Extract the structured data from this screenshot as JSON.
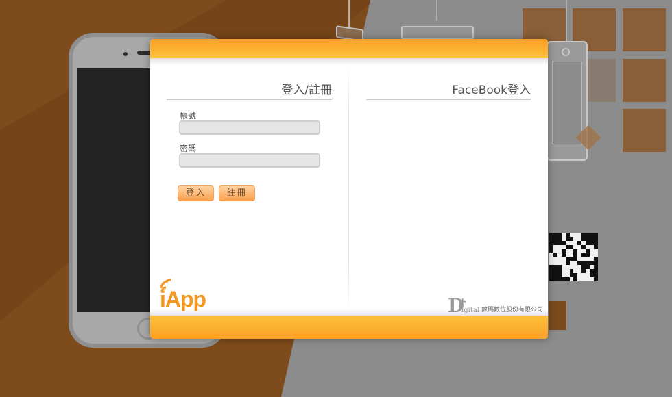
{
  "login": {
    "title": "登入/註冊",
    "account_label": "帳號",
    "password_label": "密碼",
    "account_value": "",
    "password_value": "",
    "login_button": "登入",
    "register_button": "註冊"
  },
  "facebook": {
    "title": "FaceBook登入"
  },
  "branding": {
    "app_logo_text": "iApp",
    "company_mark": "D",
    "company_mark_plus": "+",
    "company_word": "igital",
    "company_name": "數碼數位股份有限公司"
  },
  "colors": {
    "accent_orange": "#fb9f26",
    "accent_yellow": "#fcc23a",
    "button_gradient_top": "#ffd2a0",
    "button_gradient_bottom": "#fba14e",
    "background_brown": "#7e4b1c",
    "background_grey": "#8c8c8c"
  },
  "icons": {
    "app_logo": "iapp-logo-icon",
    "qr": "qr-code-icon",
    "phone": "smartphone-illustration"
  }
}
